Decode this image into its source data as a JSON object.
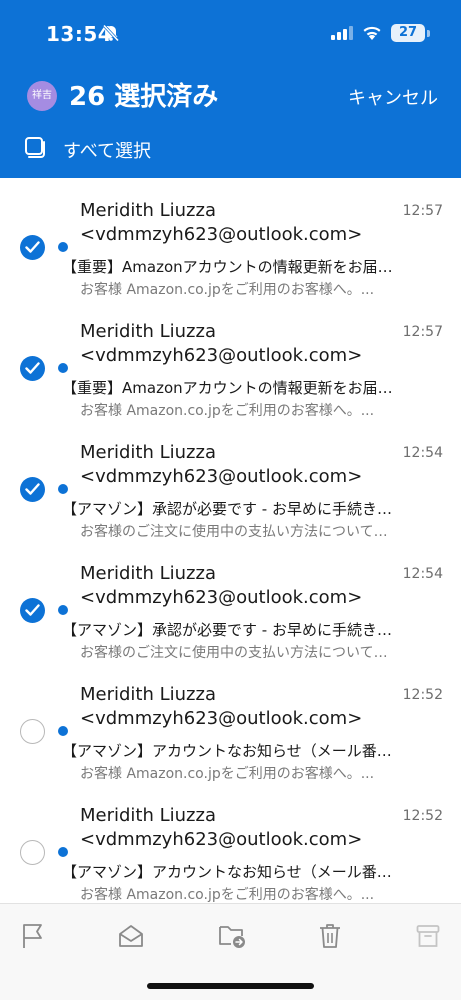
{
  "status_bar": {
    "time": "13:54",
    "battery": "27"
  },
  "header": {
    "avatar_text": "祥吉",
    "selected_title": "26 選択済み",
    "cancel_label": "キャンセル",
    "select_all_label": "すべて選択"
  },
  "emails": [
    {
      "checked": true,
      "unread": true,
      "sender": "Meridith Liuzza <vdmmzyh623@outlook.com>",
      "time": "12:57",
      "subject": "【重要】Amazonアカウントの情報更新をお届…",
      "preview": "お客様 Amazon.co.jpをご利用のお客様へ。..."
    },
    {
      "checked": true,
      "unread": true,
      "sender": "Meridith Liuzza <vdmmzyh623@outlook.com>",
      "time": "12:57",
      "subject": "【重要】Amazonアカウントの情報更新をお届…",
      "preview": "お客様 Amazon.co.jpをご利用のお客様へ。..."
    },
    {
      "checked": true,
      "unread": true,
      "sender": "Meridith Liuzza <vdmmzyh623@outlook.com>",
      "time": "12:54",
      "subject": "【アマゾン】承認が必要です - お早めに手続き…",
      "preview": "お客様のご注文に使用中の支払い方法について…"
    },
    {
      "checked": true,
      "unread": true,
      "sender": "Meridith Liuzza <vdmmzyh623@outlook.com>",
      "time": "12:54",
      "subject": "【アマゾン】承認が必要です - お早めに手続き…",
      "preview": "お客様のご注文に使用中の支払い方法について…"
    },
    {
      "checked": false,
      "unread": true,
      "sender": "Meridith Liuzza <vdmmzyh623@outlook.com>",
      "time": "12:52",
      "subject": "【アマゾン】アカウントなお知らせ（メール番…",
      "preview": "お客様 Amazon.co.jpをご利用のお客様へ。..."
    },
    {
      "checked": false,
      "unread": true,
      "sender": "Meridith Liuzza <vdmmzyh623@outlook.com>",
      "time": "12:52",
      "subject": "【アマゾン】アカウントなお知らせ（メール番…",
      "preview": "お客様 Amazon.co.jpをご利用のお客様へ。..."
    }
  ],
  "toolbar": [
    "flag-icon",
    "mark-read-icon",
    "move-folder-icon",
    "trash-icon",
    "archive-icon"
  ],
  "colors": {
    "accent": "#0d72d6",
    "avatar": "#a58ce2"
  }
}
